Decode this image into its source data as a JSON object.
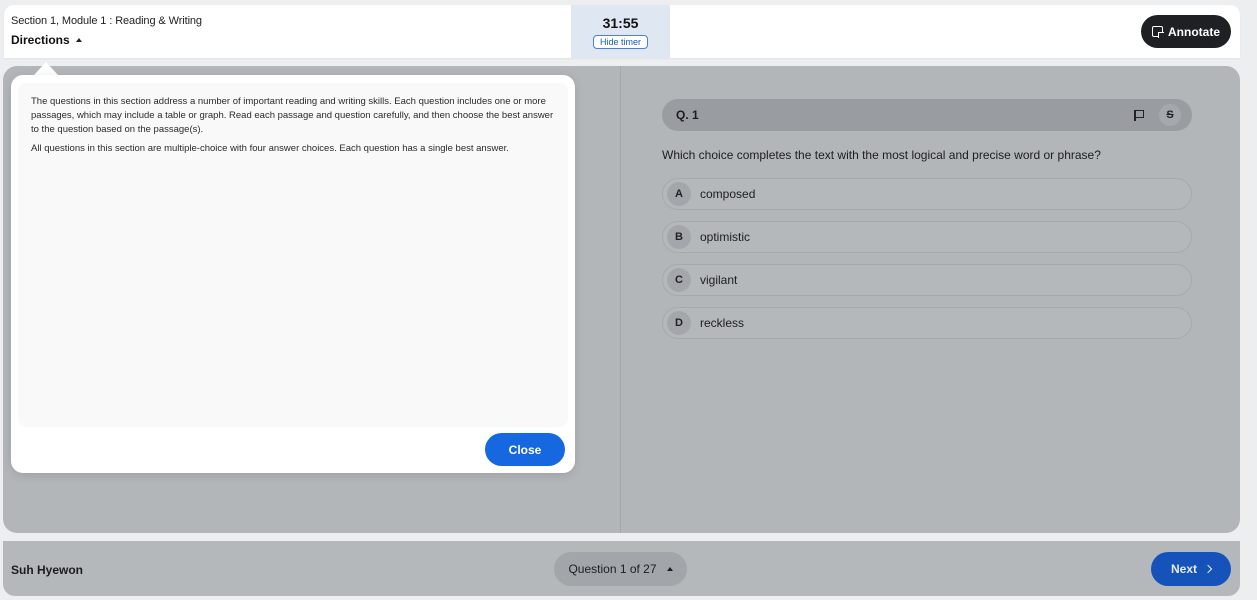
{
  "header": {
    "section_title": "Section 1, Module 1 : Reading & Writing",
    "directions_label": "Directions",
    "timer": "31:55",
    "hide_timer_label": "Hide timer",
    "annotate_label": "Annotate"
  },
  "directions": {
    "paragraphs": [
      "The questions in this section address a number of important reading and writing skills. Each question includes one or more passages, which may include a table or graph. Read each passage and question carefully, and then choose the best answer to the question based on the passage(s).",
      "All questions in this section are multiple-choice with four answer choices. Each question has a single best answer."
    ],
    "close_label": "Close"
  },
  "question": {
    "number_label": "Q. 1",
    "strike_label": "S",
    "prompt": "Which choice completes the text with the most logical and precise word or phrase?",
    "options": [
      {
        "letter": "A",
        "text": "composed"
      },
      {
        "letter": "B",
        "text": "optimistic"
      },
      {
        "letter": "C",
        "text": "vigilant"
      },
      {
        "letter": "D",
        "text": "reckless"
      }
    ]
  },
  "footer": {
    "user_name": "Suh Hyewon",
    "question_nav_label": "Question 1 of 27",
    "next_label": "Next"
  },
  "colors": {
    "primary_blue": "#1668e0",
    "annotate_dark": "#1f2023",
    "timer_bg": "#dfe7f2"
  }
}
